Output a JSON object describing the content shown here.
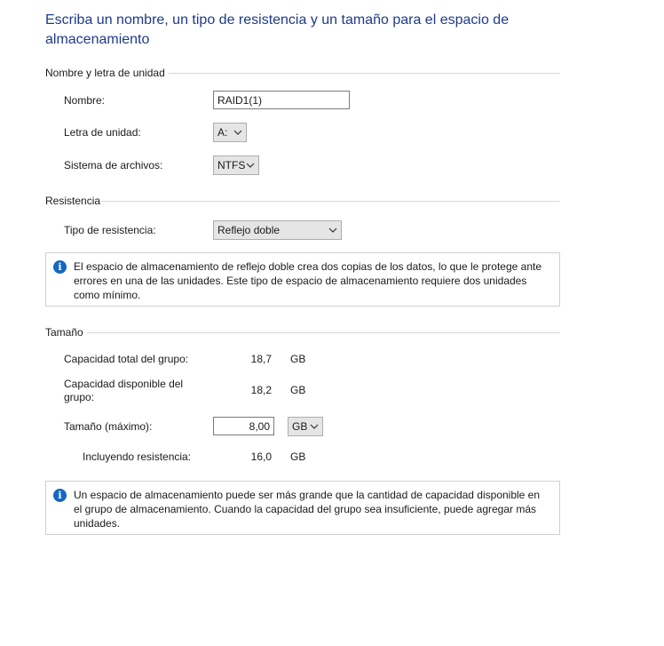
{
  "header": {
    "title": "Escriba un nombre, un tipo de resistencia y un tamaño para el espacio de almacenamiento"
  },
  "name_section": {
    "title": "Nombre y letra de unidad",
    "name_label": "Nombre:",
    "name_value": "RAID1(1)",
    "drive_letter_label": "Letra de unidad:",
    "drive_letter_value": "A:",
    "filesystem_label": "Sistema de archivos:",
    "filesystem_value": "NTFS"
  },
  "resilience_section": {
    "title": "Resistencia",
    "type_label": "Tipo de resistencia:",
    "type_value": "Reflejo doble",
    "info_text": "El espacio de almacenamiento de reflejo doble crea dos copias de los datos, lo que le protege ante errores en una de las unidades. Este tipo de espacio de almacenamiento requiere dos unidades como mínimo."
  },
  "size_section": {
    "title": "Tamaño",
    "total_capacity_label": "Capacidad total del grupo:",
    "total_capacity_value": "18,7",
    "total_capacity_unit": "GB",
    "available_capacity_label": "Capacidad disponible del grupo:",
    "available_capacity_value": "18,2",
    "available_capacity_unit": "GB",
    "size_label": "Tamaño (máximo):",
    "size_value": "8,00",
    "size_unit": "GB",
    "including_resilience_label": "Incluyendo resistencia:",
    "including_resilience_value": "16,0",
    "including_resilience_unit": "GB",
    "info_text": "Un espacio de almacenamiento puede ser más grande que la cantidad de capacidad disponible en el grupo de almacenamiento. Cuando la capacidad del grupo sea insuficiente, puede agregar más unidades."
  },
  "colors": {
    "title": "#1e3a8a",
    "info_icon": "#1667c0"
  },
  "icons": {
    "info": "info-icon",
    "dropdown": "chevron-down-icon"
  }
}
